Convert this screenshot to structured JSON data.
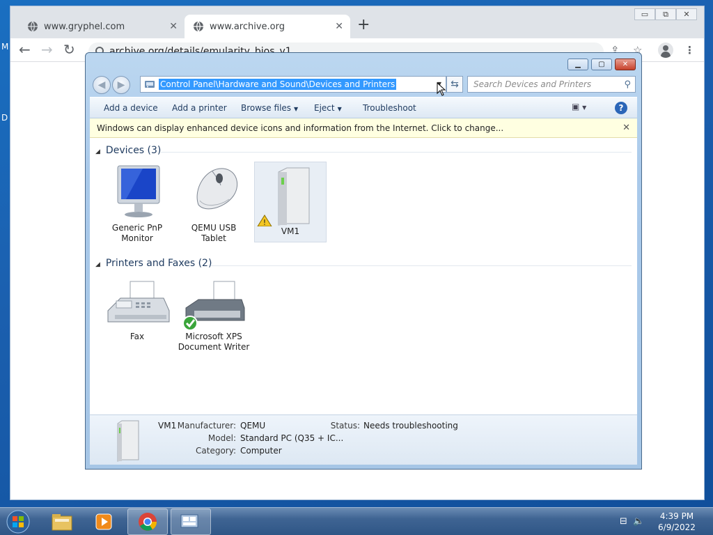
{
  "desktop": {
    "edge_letters": [
      "M",
      "D"
    ]
  },
  "browser": {
    "tabs": [
      {
        "title": "www.gryphel.com",
        "active": false
      },
      {
        "title": "www.archive.org",
        "active": true
      }
    ],
    "new_tab": "+",
    "url": "archive.org/details/emularity_bios_v1",
    "window_buttons": {
      "minimize": "▭",
      "restore": "⧉",
      "close": "✕"
    }
  },
  "explorer": {
    "address": "Control Panel\\Hardware and Sound\\Devices and Printers",
    "search_placeholder": "Search Devices and Printers",
    "commands": {
      "add_device": "Add a device",
      "add_printer": "Add a printer",
      "browse_files": "Browse files",
      "eject": "Eject",
      "troubleshoot": "Troubleshoot"
    },
    "infobar": "Windows can display enhanced device icons and information from the Internet. Click to change...",
    "groups": {
      "devices": {
        "title": "Devices (3)",
        "items": [
          {
            "label1": "Generic PnP",
            "label2": "Monitor",
            "icon": "monitor-icon"
          },
          {
            "label1": "QEMU USB",
            "label2": "Tablet",
            "icon": "mouse-icon"
          },
          {
            "label1": "VM1",
            "label2": "",
            "icon": "computer-tower-icon",
            "warning": true
          }
        ]
      },
      "printers": {
        "title": "Printers and Faxes (2)",
        "items": [
          {
            "label1": "Fax",
            "label2": "",
            "icon": "fax-icon"
          },
          {
            "label1": "Microsoft XPS",
            "label2": "Document Writer",
            "icon": "printer-icon",
            "default": true
          }
        ]
      }
    },
    "details": {
      "name": "VM1",
      "manufacturer_label": "Manufacturer:",
      "manufacturer": "QEMU",
      "model_label": "Model:",
      "model": "Standard PC (Q35 + IC...",
      "category_label": "Category:",
      "category": "Computer",
      "status_label": "Status:",
      "status": "Needs troubleshooting"
    }
  },
  "taskbar": {
    "time": "4:39 PM",
    "date": "6/9/2022",
    "items": [
      "file-explorer-icon",
      "media-player-icon",
      "chrome-icon",
      "devices-printers-icon"
    ]
  },
  "colors": {
    "selection": "#3399ff",
    "infobar": "#ffffe1",
    "header": "#1e3a5f"
  }
}
